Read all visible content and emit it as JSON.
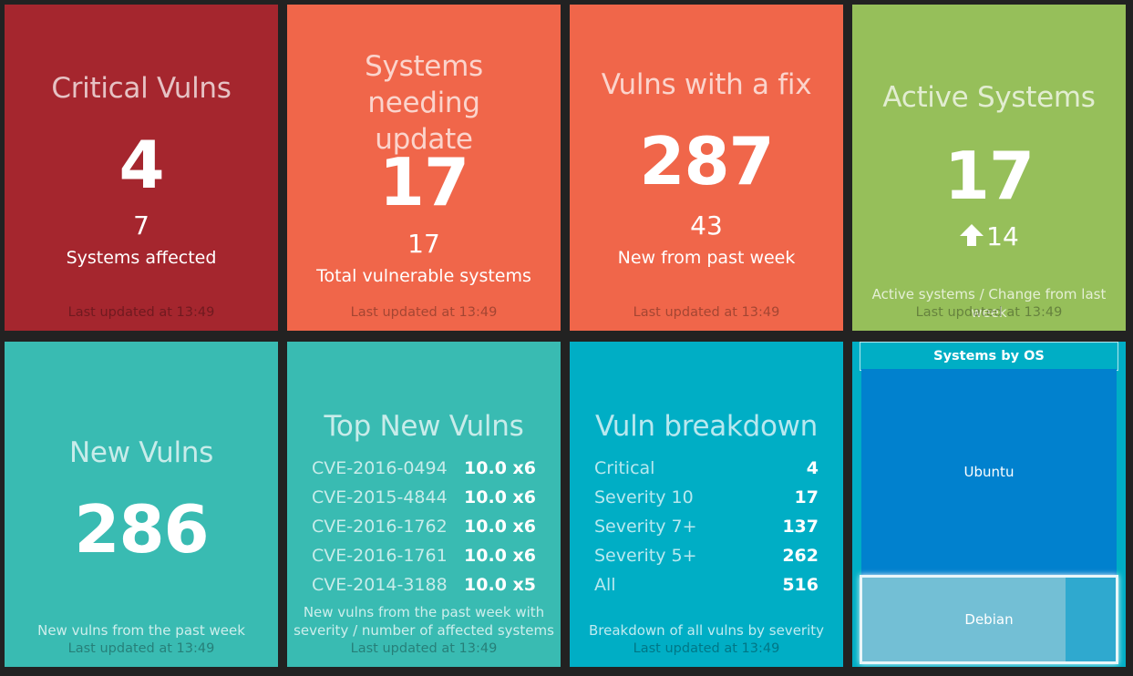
{
  "colors": {
    "background": "#222222",
    "critical": "#A5262E",
    "orange": "#F0664A",
    "green": "#96BF5A",
    "teal": "#39BBB2",
    "cyan": "#00AEC5",
    "ubuntu": "#0181CE",
    "debian": "#73BFD5"
  },
  "critical_vulns": {
    "title": "Critical Vulns",
    "value": "4",
    "secondary_value": "7",
    "secondary_label": "Systems affected",
    "updated": "Last updated at 13:49"
  },
  "systems_needing_update": {
    "title": "Systems needing update",
    "value": "17",
    "secondary_value": "17",
    "secondary_label": "Total vulnerable systems",
    "updated": "Last updated at 13:49"
  },
  "vulns_with_fix": {
    "title": "Vulns with a fix",
    "value": "287",
    "secondary_value": "43",
    "secondary_label": "New from past week",
    "updated": "Last updated at 13:49"
  },
  "active_systems": {
    "title": "Active Systems",
    "value": "17",
    "change_icon": "arrow-up-icon",
    "change": "14",
    "more_info": "Active systems / Change from last week",
    "updated": "Last updated at 13:49"
  },
  "new_vulns": {
    "title": "New Vulns",
    "value": "286",
    "more_info": "New vulns from the past week",
    "updated": "Last updated at 13:49"
  },
  "top_new_vulns": {
    "title": "Top New Vulns",
    "items": [
      {
        "label": "CVE-2016-0494",
        "value": "10.0 x6"
      },
      {
        "label": "CVE-2015-4844",
        "value": "10.0 x6"
      },
      {
        "label": "CVE-2016-1762",
        "value": "10.0 x6"
      },
      {
        "label": "CVE-2016-1761",
        "value": "10.0 x6"
      },
      {
        "label": "CVE-2014-3188",
        "value": "10.0 x5"
      }
    ],
    "more_info_line1": "New vulns from the past week with",
    "more_info_line2": "severity / number of affected systems",
    "updated": "Last updated at 13:49"
  },
  "vuln_breakdown": {
    "title": "Vuln breakdown",
    "items": [
      {
        "label": "Critical",
        "value": "4"
      },
      {
        "label": "Severity 10",
        "value": "17"
      },
      {
        "label": "Severity 7+",
        "value": "137"
      },
      {
        "label": "Severity 5+",
        "value": "262"
      },
      {
        "label": "All",
        "value": "516"
      }
    ],
    "more_info": "Breakdown of all vulns by severity",
    "updated": "Last updated at 13:49"
  },
  "systems_by_os": {
    "title": "Systems by OS",
    "cells": [
      {
        "label": "Ubuntu"
      },
      {
        "label": "Debian"
      },
      {
        "label": ""
      }
    ]
  }
}
